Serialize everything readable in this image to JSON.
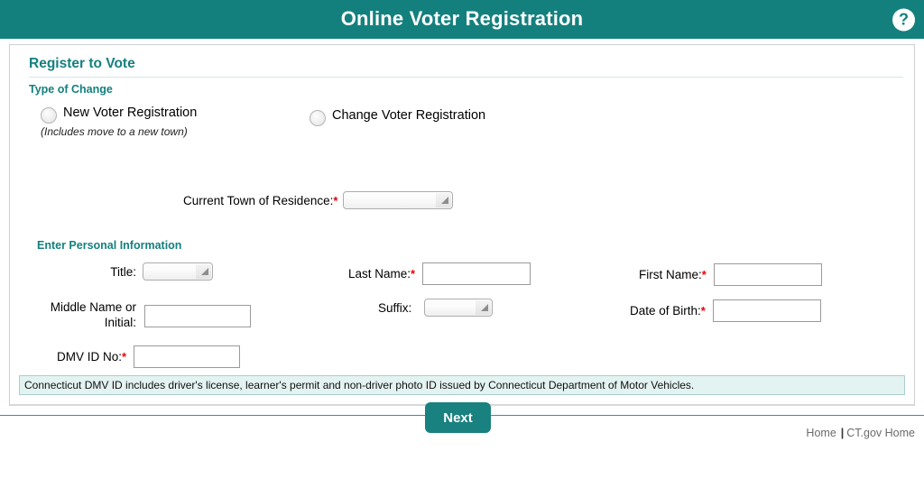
{
  "header": {
    "title": "Online Voter Registration",
    "help_icon": "question-mark-circle-icon",
    "help_label": "?",
    "background_color": "#14807e"
  },
  "form": {
    "section_title": "Register to Vote",
    "type_of_change": {
      "label": "Type of Change",
      "options": [
        {
          "label": "New Voter Registration",
          "note": "(Includes move to a new town)",
          "selected": false
        },
        {
          "label": "Change Voter Registration",
          "note": "",
          "selected": false
        }
      ]
    },
    "town": {
      "label": "Current Town of Residence:",
      "required_marker": "*",
      "value": "",
      "control": "dropdown"
    },
    "personal_section_title": "Enter Personal Information",
    "fields": {
      "title": {
        "label": "Title:",
        "value": "",
        "control": "dropdown",
        "required": false
      },
      "last_name": {
        "label": "Last Name:",
        "required_marker": "*",
        "value": "",
        "control": "text"
      },
      "first_name": {
        "label": "First Name:",
        "required_marker": "*",
        "value": "",
        "control": "text"
      },
      "middle_name": {
        "label_line1": "Middle Name or",
        "label_line2": "Initial:",
        "value": "",
        "control": "text"
      },
      "suffix": {
        "label": "Suffix:",
        "value": "",
        "control": "dropdown"
      },
      "date_of_birth": {
        "label": "Date of Birth:",
        "required_marker": "*",
        "value": "",
        "control": "text"
      },
      "dmv_id": {
        "label": "DMV ID No:",
        "required_marker": "*",
        "value": "",
        "control": "text"
      }
    },
    "info_message": "Connecticut DMV ID includes driver's license, learner's permit and non-driver photo ID issued by Connecticut Department of Motor Vehicles.",
    "next_button": "Next"
  },
  "footer": {
    "home_link": "Home",
    "divider": "|",
    "ctgov_link": "CT.gov Home"
  },
  "colors": {
    "teal": "#14807e",
    "heading_teal": "#14807e",
    "required_red": "#e8000d",
    "info_bg": "#e3f3f1",
    "info_border": "#a9cfcc"
  }
}
